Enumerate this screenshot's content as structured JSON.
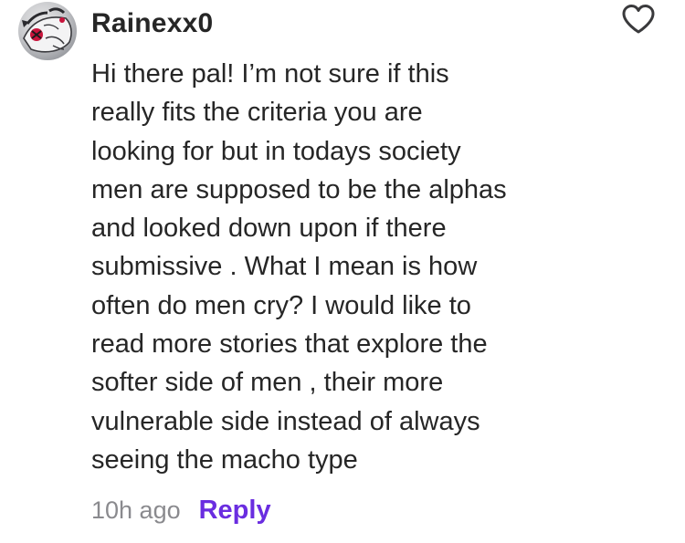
{
  "comment": {
    "username": "Rainexx0",
    "body": "Hi there pal! I’m not sure if this\nreally fits the criteria you are\nlooking for but in todays society\nmen are supposed to be the alphas\nand looked down upon if there\nsubmissive . What I mean is how\noften do men cry? I would like to\nread more stories that explore the\nsofter side of men , their more\nvulnerable side instead of always\nseeing the macho type",
    "timestamp": "10h ago",
    "reply_label": "Reply",
    "avatar_icon": "user-avatar",
    "like_icon": "heart-outline-icon"
  },
  "colors": {
    "text": "#262626",
    "muted": "#8a8a8e",
    "accent": "#6a2de0"
  }
}
